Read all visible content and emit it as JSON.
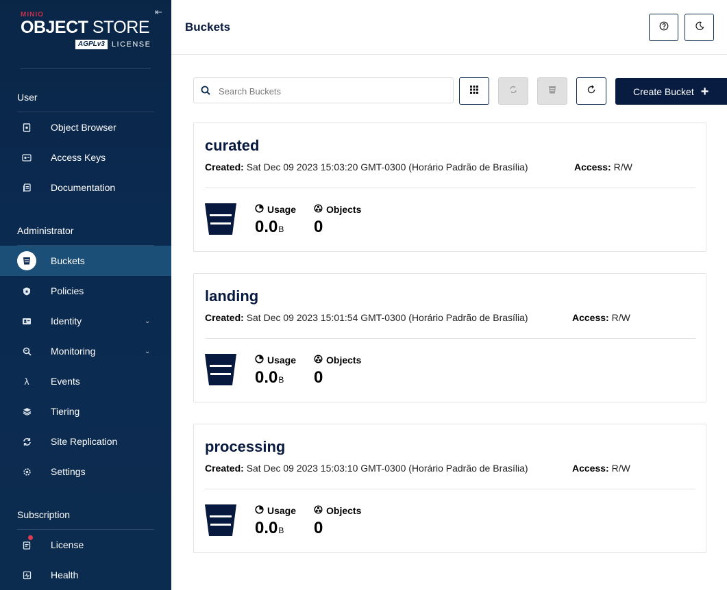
{
  "logo": {
    "brand": "MINIO",
    "product_bold": "OBJECT",
    "product_rest": "STORE",
    "badge": "AGPLv3",
    "license_label": "LICENSE"
  },
  "sidebar": {
    "sections": [
      {
        "title": "User",
        "items": [
          {
            "label": "Object Browser",
            "icon": "object-browser-icon"
          },
          {
            "label": "Access Keys",
            "icon": "access-keys-icon"
          },
          {
            "label": "Documentation",
            "icon": "documentation-icon"
          }
        ]
      },
      {
        "title": "Administrator",
        "items": [
          {
            "label": "Buckets",
            "icon": "bucket-icon",
            "active": true
          },
          {
            "label": "Policies",
            "icon": "policies-icon"
          },
          {
            "label": "Identity",
            "icon": "identity-icon",
            "expandable": true
          },
          {
            "label": "Monitoring",
            "icon": "monitoring-icon",
            "expandable": true
          },
          {
            "label": "Events",
            "icon": "lambda-icon"
          },
          {
            "label": "Tiering",
            "icon": "tiering-icon"
          },
          {
            "label": "Site Replication",
            "icon": "site-replication-icon"
          },
          {
            "label": "Settings",
            "icon": "settings-icon"
          }
        ]
      },
      {
        "title": "Subscription",
        "items": [
          {
            "label": "License",
            "icon": "license-icon",
            "notification": true
          },
          {
            "label": "Health",
            "icon": "health-icon"
          }
        ]
      }
    ]
  },
  "header": {
    "title": "Buckets"
  },
  "toolbar": {
    "search_placeholder": "Search Buckets",
    "create_label": "Create Bucket"
  },
  "buckets": [
    {
      "name": "curated",
      "created_label": "Created:",
      "created": "Sat Dec 09 2023 15:03:20 GMT-0300 (Horário Padrão de Brasília)",
      "access_label": "Access:",
      "access": "R/W",
      "usage_label": "Usage",
      "usage_value": "0.0",
      "usage_unit": "B",
      "objects_label": "Objects",
      "objects_value": "0"
    },
    {
      "name": "landing",
      "created_label": "Created:",
      "created": "Sat Dec 09 2023 15:01:54 GMT-0300 (Horário Padrão de Brasília)",
      "access_label": "Access:",
      "access": "R/W",
      "usage_label": "Usage",
      "usage_value": "0.0",
      "usage_unit": "B",
      "objects_label": "Objects",
      "objects_value": "0"
    },
    {
      "name": "processing",
      "created_label": "Created:",
      "created": "Sat Dec 09 2023 15:03:10 GMT-0300 (Horário Padrão de Brasília)",
      "access_label": "Access:",
      "access": "R/W",
      "usage_label": "Usage",
      "usage_value": "0.0",
      "usage_unit": "B",
      "objects_label": "Objects",
      "objects_value": "0"
    }
  ],
  "colors": {
    "sidebar_bg": "#0b2a50",
    "active_item": "#1b4f77",
    "primary": "#081c42",
    "notification": "#e03a52"
  }
}
